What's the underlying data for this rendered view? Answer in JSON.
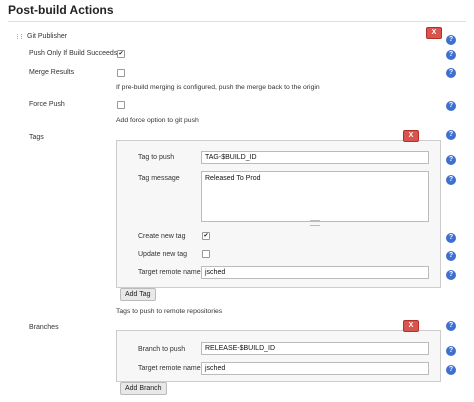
{
  "page": {
    "title": "Post-build Actions"
  },
  "git_publisher": {
    "label": "Git Publisher",
    "delete_label": "X",
    "push_only_label": "Push Only If Build Succeeds",
    "merge_results_label": "Merge Results",
    "merge_hint": "If pre-build merging is configured, push the merge back to the origin",
    "force_push_label": "Force Push",
    "force_hint": "Add force option to git push",
    "tags_label": "Tags",
    "tags_hint": "Tags to push to remote repositories",
    "branches_label": "Branches"
  },
  "tag_entry": {
    "delete_label": "X",
    "tag_to_push_label": "Tag to push",
    "tag_to_push_value": "TAG-$BUILD_ID",
    "tag_message_label": "Tag message",
    "tag_message_value": "Released To Prod",
    "create_new_tag_label": "Create new tag",
    "update_new_tag_label": "Update new tag",
    "target_remote_label": "Target remote name",
    "target_remote_value": "jsched",
    "add_tag_label": "Add Tag"
  },
  "branch_entry": {
    "delete_label": "X",
    "branch_to_push_label": "Branch to push",
    "branch_to_push_value": "RELEASE-$BUILD_ID",
    "target_remote_label": "Target remote name",
    "target_remote_value": "jsched",
    "add_branch_label": "Add Branch"
  },
  "help": {
    "symbol": "?"
  },
  "checks": {
    "checked": "✔",
    "unchecked": ""
  }
}
